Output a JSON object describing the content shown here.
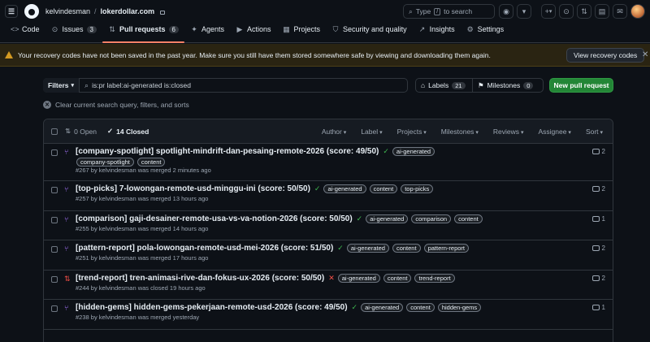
{
  "header": {
    "owner": "kelvindesman",
    "separator": "/",
    "repo": "lokerdollar.com",
    "search_prefix": "Type",
    "search_key": "/",
    "search_suffix": "to search",
    "plus": "+",
    "plus_caret": "▾"
  },
  "repo_nav": {
    "tabs": [
      {
        "label": "Code",
        "icon": "code-icon",
        "glyph": "<>"
      },
      {
        "label": "Issues",
        "count": "3",
        "icon": "issue-icon",
        "glyph": "⊙"
      },
      {
        "label": "Pull requests",
        "count": "6",
        "icon": "pull-request-icon",
        "glyph": "⇅"
      },
      {
        "label": "Agents",
        "icon": "agent-icon",
        "glyph": "✦"
      },
      {
        "label": "Actions",
        "icon": "play-icon",
        "glyph": "▶"
      },
      {
        "label": "Projects",
        "icon": "table-icon",
        "glyph": "▦"
      },
      {
        "label": "Security and quality",
        "icon": "shield-icon",
        "glyph": "⛉"
      },
      {
        "label": "Insights",
        "icon": "graph-icon",
        "glyph": "↗"
      },
      {
        "label": "Settings",
        "icon": "gear-icon",
        "glyph": "⚙"
      }
    ]
  },
  "banner": {
    "text": "Your recovery codes have not been saved in the past year. Make sure you still have them stored somewhere safe by viewing and downloading them again.",
    "button": "View recovery codes",
    "close": "✕",
    "color": "#d29922"
  },
  "filter": {
    "button": "Filters",
    "query": "is:pr label:ai-generated is:closed",
    "labels_label": "Labels",
    "labels_count": "21",
    "milestones_label": "Milestones",
    "milestones_count": "0",
    "new_pr": "New pull request",
    "clear_text": "Clear current search query, filters, and sorts"
  },
  "list_header": {
    "open_label": "0 Open",
    "closed_label": "14 Closed",
    "filters": [
      "Author",
      "Label",
      "Projects",
      "Milestones",
      "Reviews",
      "Assignee",
      "Sort"
    ]
  },
  "pull_requests": [
    {
      "title": "[company-spotlight] spotlight-mindrift-dan-pesaing-remote-2026 (score: 49/50)",
      "status": "merged",
      "check": "pass",
      "labels_inline": [
        "ai-generated"
      ],
      "labels_below": [
        "company-spotlight",
        "content"
      ],
      "meta": "#267 by kelvindesman was merged 2 minutes ago",
      "comments": "2"
    },
    {
      "title": "[top-picks] 7-lowongan-remote-usd-minggu-ini (score: 50/50)",
      "status": "merged",
      "check": "pass",
      "labels_inline": [
        "ai-generated",
        "content",
        "top-picks"
      ],
      "labels_below": [],
      "meta": "#257 by kelvindesman was merged 13 hours ago",
      "comments": "2"
    },
    {
      "title": "[comparison] gaji-desainer-remote-usa-vs-va-notion-2026 (score: 50/50)",
      "status": "merged",
      "check": "pass",
      "labels_inline": [
        "ai-generated",
        "comparison",
        "content"
      ],
      "labels_below": [],
      "meta": "#255 by kelvindesman was merged 14 hours ago",
      "comments": "1"
    },
    {
      "title": "[pattern-report] pola-lowongan-remote-usd-mei-2026 (score: 51/50)",
      "status": "merged",
      "check": "pass",
      "labels_inline": [
        "ai-generated",
        "content",
        "pattern-report"
      ],
      "labels_below": [],
      "meta": "#251 by kelvindesman was merged 17 hours ago",
      "comments": "2"
    },
    {
      "title": "[trend-report] tren-animasi-rive-dan-fokus-ux-2026 (score: 50/50)",
      "status": "closed",
      "check": "fail",
      "labels_inline": [
        "ai-generated",
        "content",
        "trend-report"
      ],
      "labels_below": [],
      "meta": "#244 by kelvindesman was closed 19 hours ago",
      "comments": "2"
    },
    {
      "title": "[hidden-gems] hidden-gems-pekerjaan-remote-usd-2026 (score: 49/50)",
      "status": "merged",
      "check": "pass",
      "labels_inline": [
        "ai-generated",
        "content",
        "hidden-gems"
      ],
      "labels_below": [],
      "meta": "#238 by kelvindesman was merged yesterday",
      "comments": "1"
    }
  ]
}
